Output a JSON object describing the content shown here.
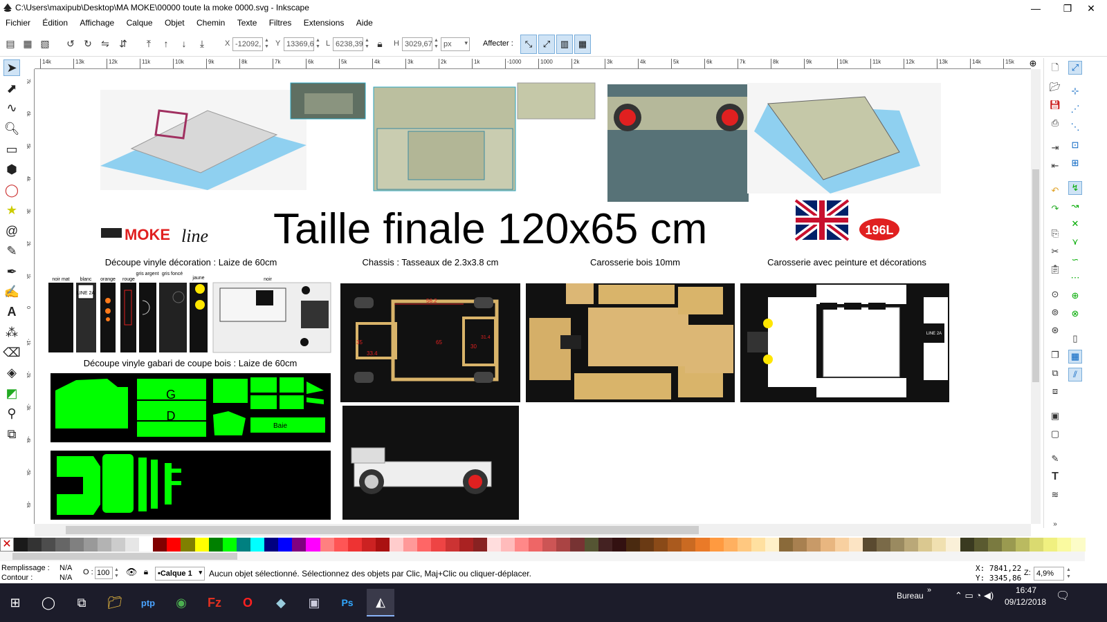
{
  "window": {
    "title": "C:\\Users\\maxipub\\Desktop\\MA MOKE\\00000 toute la moke 0000.svg - Inkscape",
    "minimize": "—",
    "maximize": "❐",
    "close": "✕"
  },
  "menu": [
    "Fichier",
    "Édition",
    "Affichage",
    "Calque",
    "Objet",
    "Chemin",
    "Texte",
    "Filtres",
    "Extensions",
    "Aide"
  ],
  "toolbar": {
    "x_label": "X",
    "x_value": "-12092,",
    "y_label": "Y",
    "y_value": "13369,6",
    "w_label": "L",
    "w_value": "6238,39",
    "h_label": "H",
    "h_value": "3029,67",
    "unit": "px",
    "affecter_label": "Affecter :"
  },
  "ruler": {
    "h_ticks": [
      "14k",
      "13k",
      "12k",
      "11k",
      "10k",
      "9k",
      "8k",
      "7k",
      "6k",
      "5k",
      "4k",
      "3k",
      "2k",
      "1k",
      "-1000",
      "1000",
      "2k",
      "3k",
      "4k",
      "5k",
      "6k",
      "7k",
      "8k",
      "9k",
      "10k",
      "11k",
      "12k",
      "13k",
      "14k",
      "15k"
    ],
    "v_ticks": [
      "7k",
      "6k",
      "5k",
      "4k",
      "3k",
      "2k",
      "1k",
      "0",
      "-1k",
      "-2k",
      "-3k",
      "-4k",
      "-5k",
      "-6k"
    ]
  },
  "canvas": {
    "headline": "Taille finale 120x65 cm",
    "logo_text": "MOKE",
    "logo_script": "line",
    "badge": "196L",
    "captions": {
      "vinyl_deco": "Découpe vinyle décoration : Laize de 60cm",
      "chassis": "Chassis : Tasseaux de 2.3x3.8 cm",
      "carrosserie_bois": "Carosserie bois 10mm",
      "carrosserie_peinture": "Carosserie avec peinture et décorations",
      "vinyl_gabari": "Découpe vinyle gabari de coupe bois : Laize de 60cm"
    },
    "swatch_labels": [
      "noir mat",
      "blanc",
      "orange",
      "rouge",
      "gris argent",
      "gris foncé",
      "jaune",
      "noir"
    ],
    "stickers": [
      "LINE 2A",
      "LINE 2A"
    ],
    "gabari_letters": [
      "G",
      "D",
      "Baie"
    ],
    "chassis_dims": [
      "56.2",
      "33.4",
      "65",
      "30",
      "31.4",
      "35"
    ]
  },
  "status": {
    "fill_label": "Remplissage :",
    "fill_value": "N/A",
    "stroke_label": "Contour :",
    "stroke_value": "N/A",
    "opacity_label": "O :",
    "opacity_value": "100",
    "layer": "•Calque 1",
    "message": "Aucun objet sélectionné. Sélectionnez des objets par Clic, Maj+Clic ou cliquer-déplacer.",
    "coord_x": "X: 7841,22",
    "coord_y": "Y: 3345,86",
    "zoom_label": "Z:",
    "zoom_value": "4,9%"
  },
  "taskbar": {
    "desktop_label": "Bureau",
    "time": "16:47",
    "date": "09/12/2018"
  },
  "colors": {
    "accent": "#0078d7",
    "green": "#00ff00",
    "wood": "#d9b46a"
  }
}
